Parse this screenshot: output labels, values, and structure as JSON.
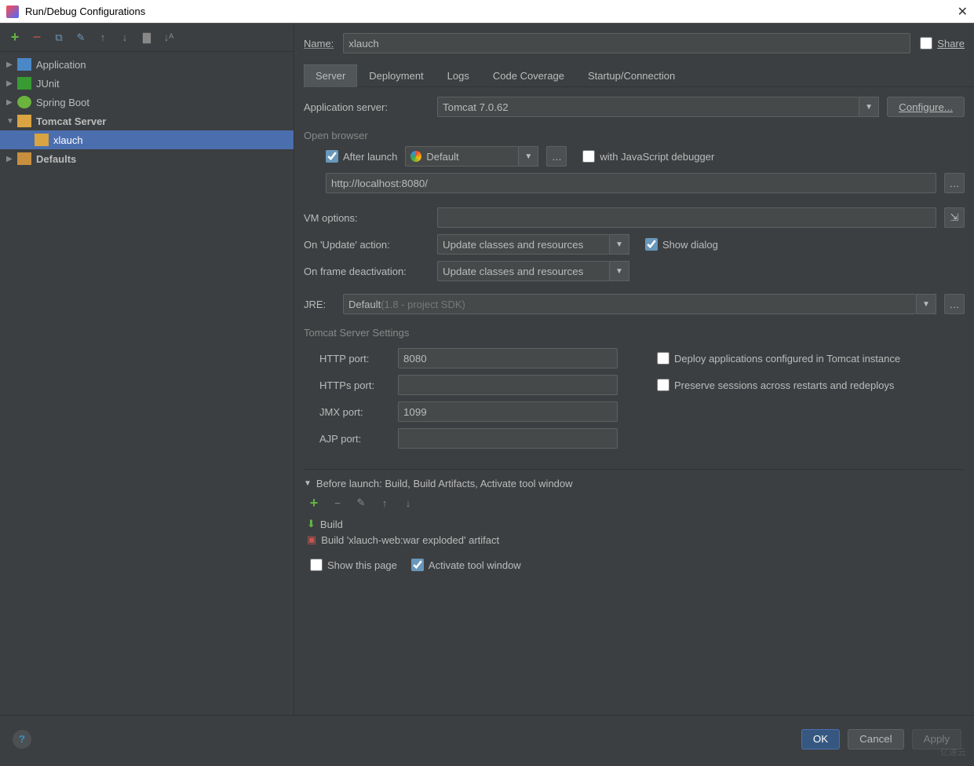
{
  "window": {
    "title": "Run/Debug Configurations"
  },
  "share_label": "Share",
  "name_label": "Name:",
  "name_value": "xlauch",
  "tree": {
    "items": [
      "Application",
      "JUnit",
      "Spring Boot",
      "Tomcat Server",
      "Defaults"
    ],
    "nested": "xlauch"
  },
  "tabs": [
    "Server",
    "Deployment",
    "Logs",
    "Code Coverage",
    "Startup/Connection"
  ],
  "appserver": {
    "label": "Application server:",
    "value": "Tomcat 7.0.62",
    "configure": "Configure..."
  },
  "openbrowser": {
    "legend": "Open browser",
    "after_launch": "After launch",
    "browser": "Default",
    "js_debugger": "with JavaScript debugger",
    "url": "http://localhost:8080/"
  },
  "vm": {
    "label": "VM options:",
    "value": ""
  },
  "update": {
    "label": "On 'Update' action:",
    "value": "Update classes and resources",
    "show_dialog": "Show dialog"
  },
  "frame": {
    "label": "On frame deactivation:",
    "value": "Update classes and resources"
  },
  "jre": {
    "label": "JRE:",
    "prefix": "Default ",
    "hint": "(1.8 - project SDK)"
  },
  "tomcat_settings": {
    "legend": "Tomcat Server Settings",
    "http_label": "HTTP port:",
    "http": "8080",
    "https_label": "HTTPs port:",
    "https": "",
    "jmx_label": "JMX port:",
    "jmx": "1099",
    "ajp_label": "AJP port:",
    "ajp": "",
    "deploy": "Deploy applications configured in Tomcat instance",
    "preserve": "Preserve sessions across restarts and redeploys"
  },
  "before": {
    "title": "Before launch: Build, Build Artifacts, Activate tool window",
    "items": [
      "Build",
      "Build 'xlauch-web:war exploded' artifact"
    ]
  },
  "footer_opts": {
    "show_page": "Show this page",
    "activate": "Activate tool window"
  },
  "buttons": {
    "ok": "OK",
    "cancel": "Cancel",
    "apply": "Apply"
  }
}
